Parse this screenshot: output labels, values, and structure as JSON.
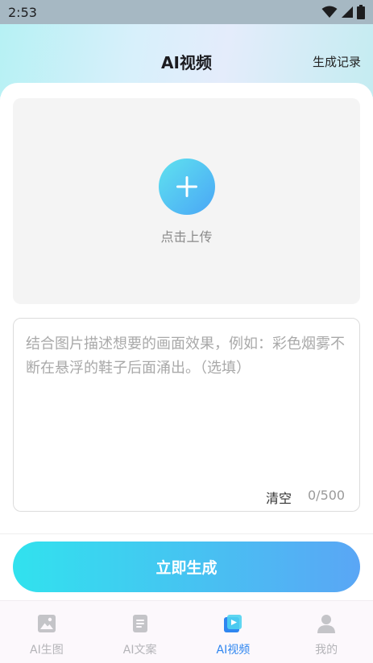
{
  "status_bar": {
    "time": "2:53"
  },
  "header": {
    "title": "AI视频",
    "history_label": "生成记录"
  },
  "upload": {
    "label": "点击上传"
  },
  "prompt": {
    "placeholder": "结合图片描述想要的画面效果，例如：彩色烟雾不断在悬浮的鞋子后面涌出。（选填）",
    "value": "",
    "clear_label": "清空",
    "char_count": "0/500"
  },
  "generate": {
    "label": "立即生成"
  },
  "tabbar": {
    "tabs": [
      {
        "label": "AI生图",
        "icon": "image-icon",
        "active": false
      },
      {
        "label": "AI文案",
        "icon": "document-icon",
        "active": false
      },
      {
        "label": "AI视频",
        "icon": "video-icon",
        "active": true
      },
      {
        "label": "我的",
        "icon": "user-icon",
        "active": false
      }
    ]
  },
  "colors": {
    "accent": "#2f86f0",
    "gradient_start": "#31e2ee",
    "gradient_end": "#5aa6f5",
    "inactive_tab": "#b4b4b8"
  }
}
